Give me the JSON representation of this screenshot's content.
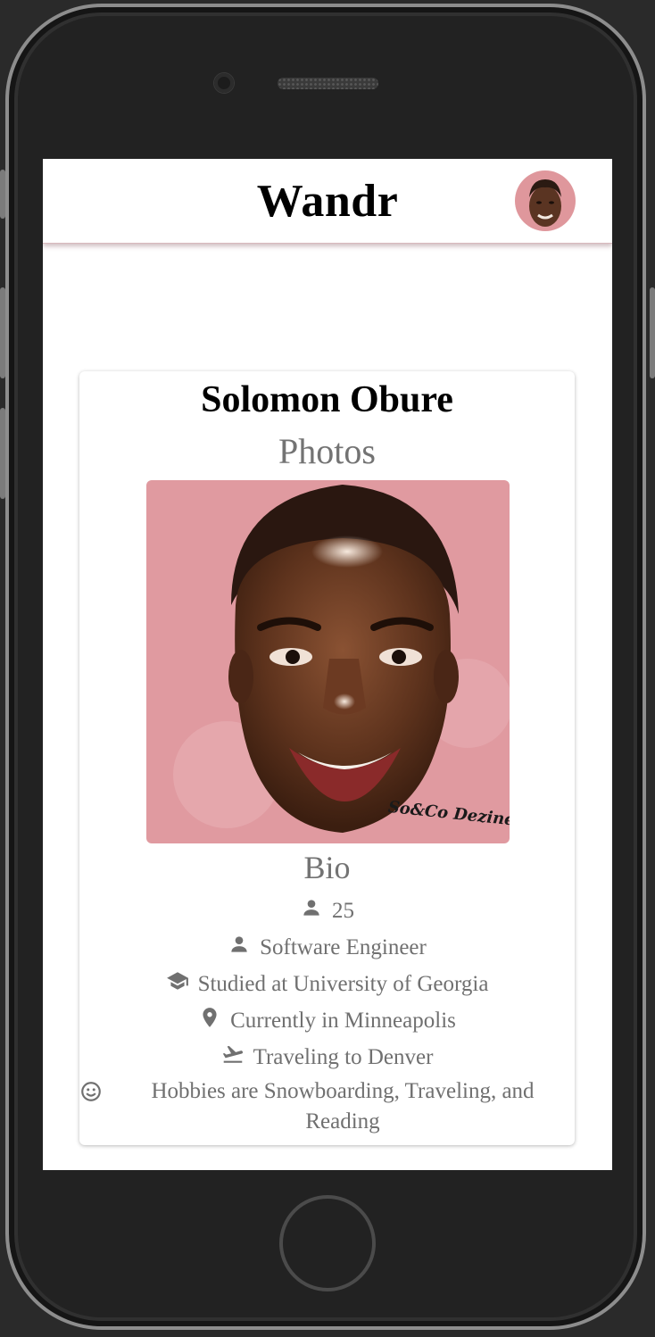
{
  "app": {
    "title": "Wandr"
  },
  "profile": {
    "name": "Solomon Obure",
    "photos_heading": "Photos",
    "photo_watermark": "So&Co Dezine",
    "bio_heading": "Bio",
    "bio": {
      "age": "25",
      "occupation": "Software Engineer",
      "education": "Studied at University of Georgia",
      "location": "Currently in Minneapolis",
      "traveling": "Traveling to Denver",
      "hobbies": "Hobbies are Snowboarding, Traveling, and Reading"
    }
  },
  "icons": {
    "age": "person-icon",
    "occupation": "person-icon",
    "education": "school-icon",
    "location": "location-pin-icon",
    "traveling": "flight-takeoff-icon",
    "hobbies": "smiley-icon"
  },
  "colors": {
    "photo_background": "#e09aa0",
    "muted_text": "#707070"
  }
}
